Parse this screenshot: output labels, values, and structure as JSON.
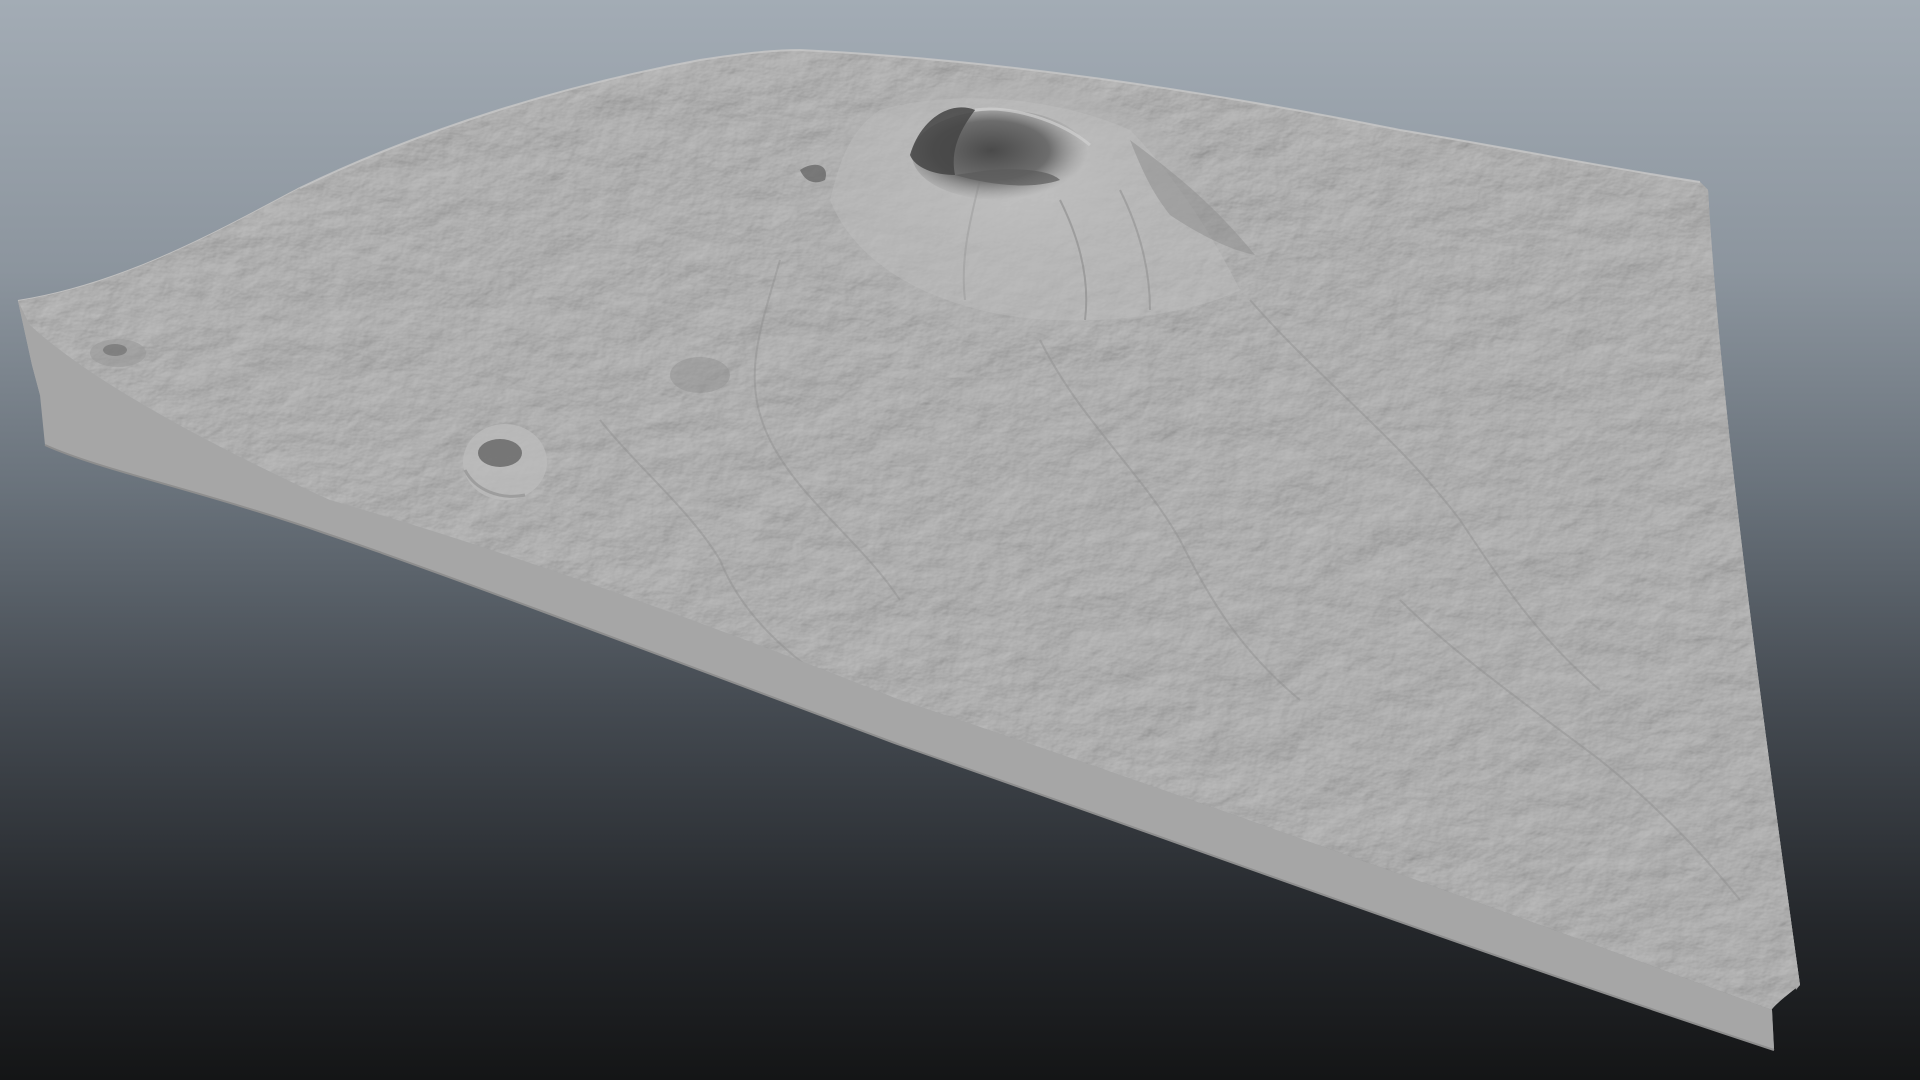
{
  "viewport": {
    "background_top": "#a3acb5",
    "background_bottom": "#141516"
  },
  "terrain": {
    "surface_color": "#aeaeae",
    "side_color": "#a2a2a2",
    "features": [
      "main-volcano-cone",
      "summit-crater",
      "secondary-crater-left",
      "small-cone-far-left",
      "lava-flows"
    ]
  }
}
